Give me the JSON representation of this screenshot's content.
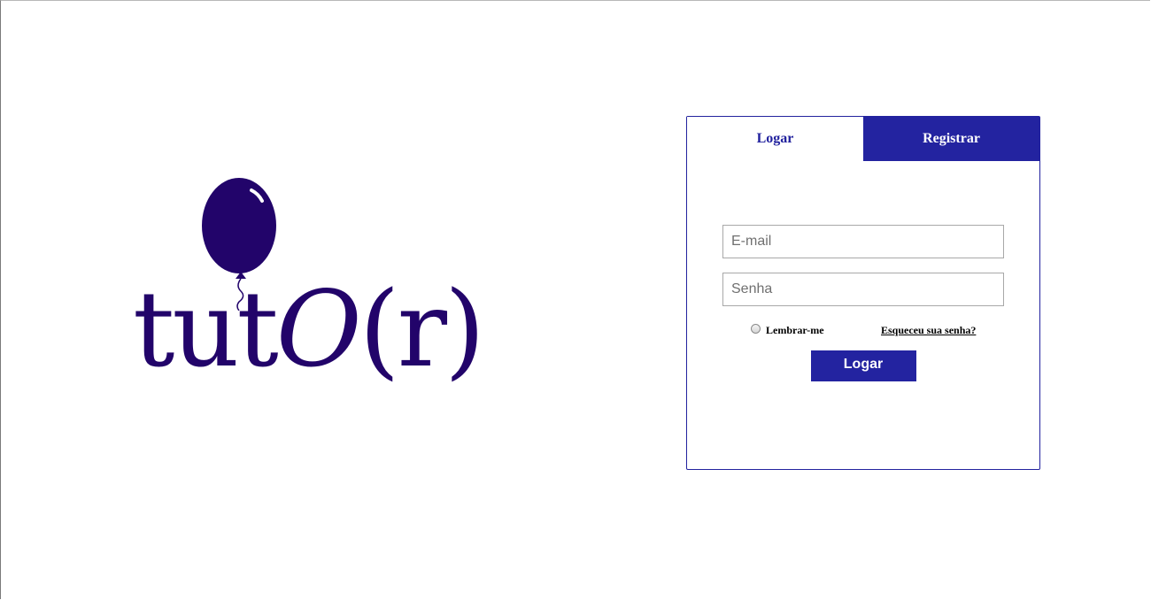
{
  "brand": {
    "logo_text_prefix": "tut",
    "logo_text_o": "O",
    "logo_text_suffix": "(r)",
    "color": "#22046a"
  },
  "auth": {
    "tabs": [
      {
        "label": "Logar",
        "active": true
      },
      {
        "label": "Registrar",
        "active": false
      }
    ],
    "email_placeholder": "E-mail",
    "password_placeholder": "Senha",
    "remember_label": "Lembrar-me",
    "forgot_label": "Esqueceu sua senha?",
    "submit_label": "Logar",
    "accent_color": "#2323a0"
  }
}
